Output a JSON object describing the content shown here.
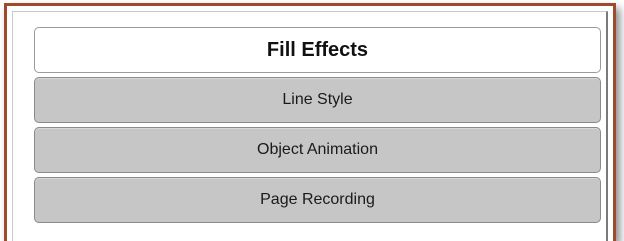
{
  "panel": {
    "items": [
      {
        "label": "Fill Effects",
        "active": true
      },
      {
        "label": "Line Style",
        "active": false
      },
      {
        "label": "Object Animation",
        "active": false
      },
      {
        "label": "Page Recording",
        "active": false
      }
    ]
  }
}
